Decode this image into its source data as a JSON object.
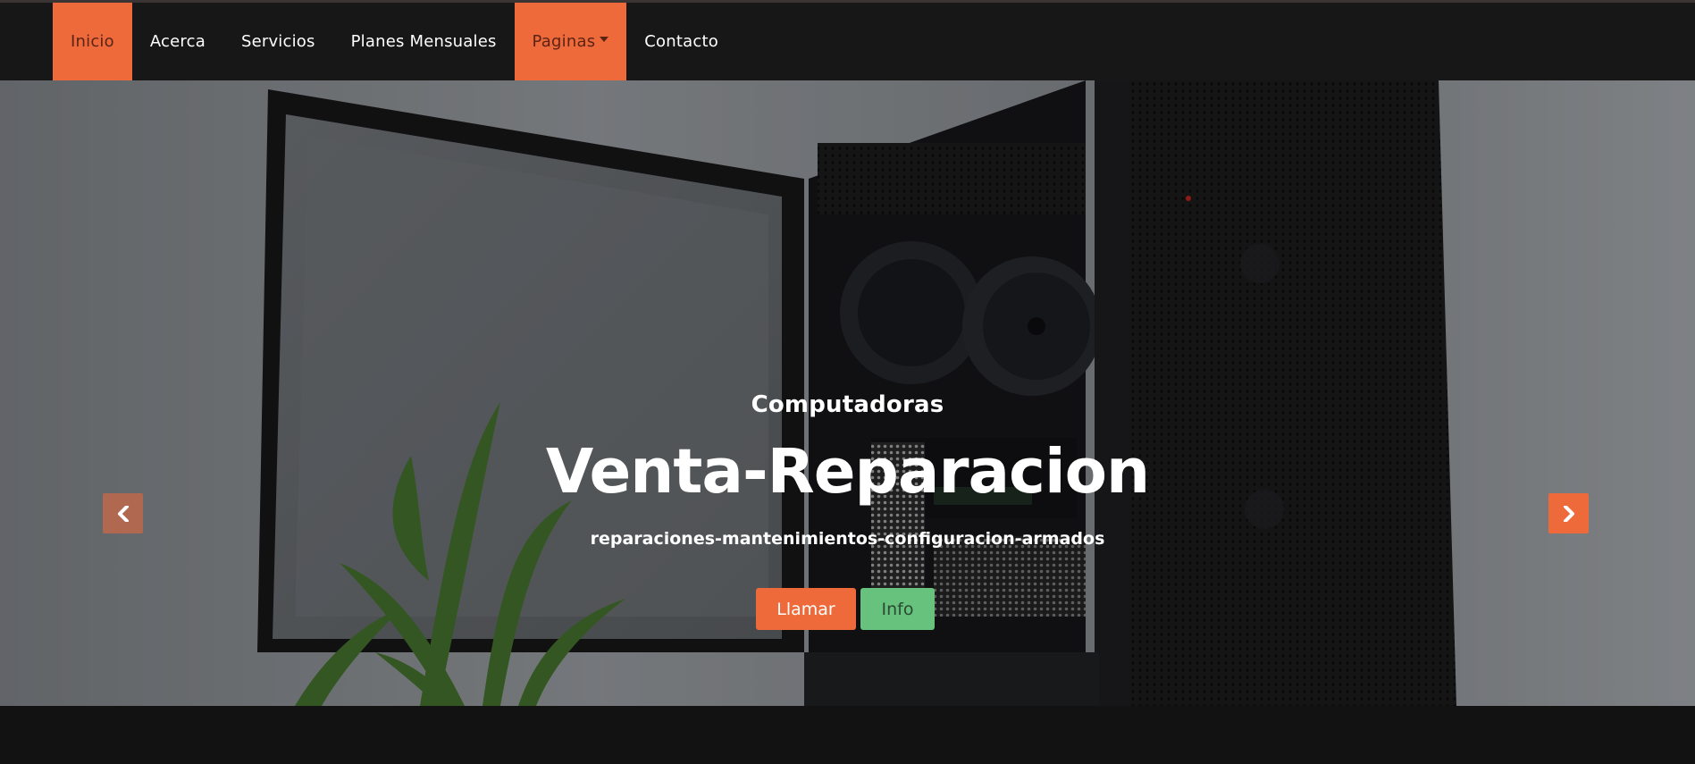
{
  "nav": {
    "items": [
      {
        "label": "Inicio",
        "active": true
      },
      {
        "label": "Acerca",
        "active": false
      },
      {
        "label": "Servicios",
        "active": false
      },
      {
        "label": "Planes Mensuales",
        "active": false
      },
      {
        "label": "Paginas",
        "active": true,
        "dropdown": true
      },
      {
        "label": "Contacto",
        "active": false
      }
    ]
  },
  "hero": {
    "kicker": "Computadoras",
    "headline": "Venta-Reparacion",
    "subline": "reparaciones-mantenimientos-configuracion-armados",
    "call_button": "Llamar",
    "info_button": "Info",
    "prev_icon": "chevron-left-icon",
    "next_icon": "chevron-right-icon"
  },
  "colors": {
    "accent": "#ee6a3b",
    "success": "#66c27d",
    "navbar": "#171717",
    "page": "#121212"
  }
}
